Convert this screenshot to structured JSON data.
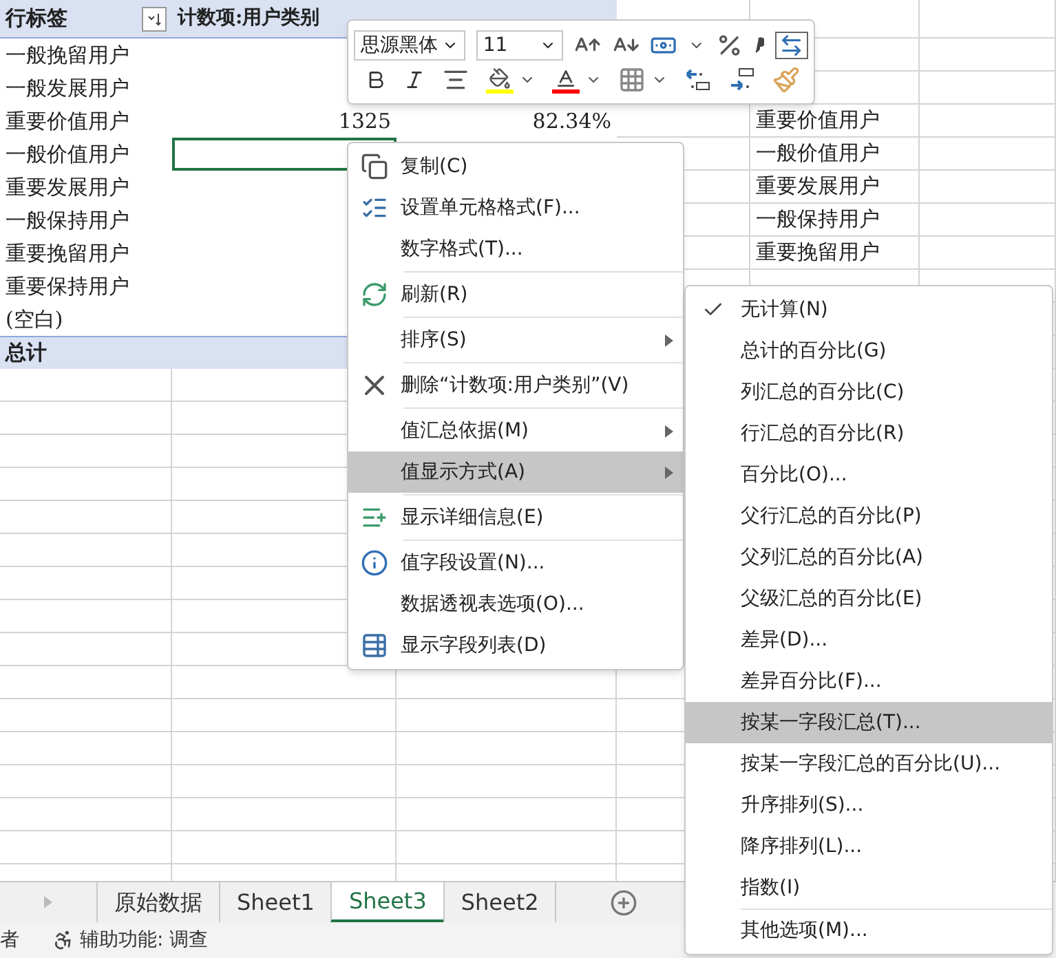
{
  "pivot": {
    "header": {
      "row_label": "行标签",
      "column_2": "计数项:用户类别"
    },
    "rows": [
      {
        "label": "一般挽留用户",
        "selected": false
      },
      {
        "label": "一般发展用户",
        "selected": false
      },
      {
        "label": "重要价值用户",
        "count": "1325",
        "percent": "82.34%",
        "column_e": "重要价值用户",
        "selected": false
      },
      {
        "label": "一般价值用户",
        "column_e": "一般价值用户",
        "selected": true
      },
      {
        "label": "重要发展用户",
        "column_e": "重要发展用户",
        "selected": false
      },
      {
        "label": "一般保持用户",
        "column_e": "一般保持用户",
        "selected": false
      },
      {
        "label": "重要挽留用户",
        "column_e": "重要挽留用户",
        "selected": false
      },
      {
        "label": "重要保持用户",
        "selected": false
      },
      {
        "label": "(空白)",
        "selected": false
      }
    ],
    "total": {
      "label": "总计"
    }
  },
  "mini_toolbar": {
    "font": "思源黑体",
    "size": "11"
  },
  "context_menu": {
    "items": [
      {
        "label": "复制(C)",
        "selected": false,
        "submenu": false,
        "divider_after": false
      },
      {
        "label": "设置单元格格式(F)...",
        "selected": false,
        "submenu": false,
        "divider_after": false
      },
      {
        "label": "数字格式(T)...",
        "selected": false,
        "submenu": false,
        "divider_after": true
      },
      {
        "label": "刷新(R)",
        "selected": false,
        "submenu": false,
        "divider_after": true
      },
      {
        "label": "排序(S)",
        "selected": false,
        "submenu": true,
        "divider_after": true
      },
      {
        "label": "删除“计数项:用户类别”(V)",
        "selected": false,
        "submenu": false,
        "divider_after": true
      },
      {
        "label": "值汇总依据(M)",
        "selected": false,
        "submenu": true,
        "divider_after": false
      },
      {
        "label": "值显示方式(A)",
        "selected": true,
        "submenu": true,
        "divider_after": true
      },
      {
        "label": "显示详细信息(E)",
        "selected": false,
        "submenu": false,
        "divider_after": true
      },
      {
        "label": "值字段设置(N)...",
        "selected": false,
        "submenu": false,
        "divider_after": false
      },
      {
        "label": "数据透视表选项(O)...",
        "selected": false,
        "submenu": false,
        "divider_after": false
      },
      {
        "label": "显示字段列表(D)",
        "selected": false,
        "submenu": false,
        "divider_after": false
      }
    ]
  },
  "submenu": {
    "items": [
      {
        "label": "无计算(N)",
        "checked": true,
        "selected": false
      },
      {
        "label": "总计的百分比(G)",
        "checked": false,
        "selected": false
      },
      {
        "label": "列汇总的百分比(C)",
        "checked": false,
        "selected": false
      },
      {
        "label": "行汇总的百分比(R)",
        "checked": false,
        "selected": false
      },
      {
        "label": "百分比(O)...",
        "checked": false,
        "selected": false
      },
      {
        "label": "父行汇总的百分比(P)",
        "checked": false,
        "selected": false
      },
      {
        "label": "父列汇总的百分比(A)",
        "checked": false,
        "selected": false
      },
      {
        "label": "父级汇总的百分比(E)",
        "checked": false,
        "selected": false
      },
      {
        "label": "差异(D)...",
        "checked": false,
        "selected": false
      },
      {
        "label": "差异百分比(F)...",
        "checked": false,
        "selected": false
      },
      {
        "label": "按某一字段汇总(T)...",
        "checked": false,
        "selected": true
      },
      {
        "label": "按某一字段汇总的百分比(U)...",
        "checked": false,
        "selected": false
      },
      {
        "label": "升序排列(S)...",
        "checked": false,
        "selected": false
      },
      {
        "label": "降序排列(L)...",
        "checked": false,
        "selected": false
      },
      {
        "label": "指数(I)",
        "checked": false,
        "selected": false
      },
      {
        "label": "其他选项(M)...",
        "checked": false,
        "selected": false
      }
    ]
  },
  "sheet_tabs": [
    {
      "label": "原始数据",
      "selected": false
    },
    {
      "label": "Sheet1",
      "selected": false
    },
    {
      "label": "Sheet3",
      "selected": true
    },
    {
      "label": "Sheet2",
      "selected": false
    }
  ],
  "status_bar": {
    "left": "者",
    "accessibility": "辅助功能: 调查"
  }
}
